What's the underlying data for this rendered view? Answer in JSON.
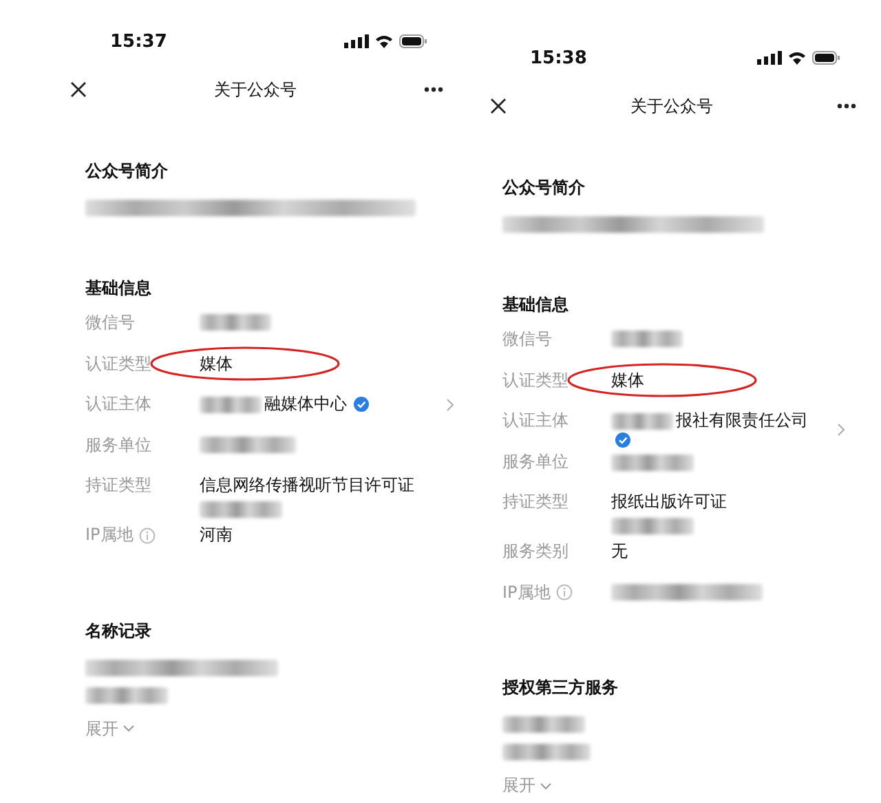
{
  "phones": [
    {
      "status_bar": {
        "time": "15:37"
      },
      "nav": {
        "title": "关于公众号"
      },
      "sections": [
        {
          "title": "公众号简介",
          "items": [
            {
              "kind": "blurline"
            }
          ]
        },
        {
          "title": "基础信息",
          "items": [
            {
              "kind": "field",
              "label": "微信号",
              "info": false,
              "verified": false,
              "chevron": false,
              "circled": false,
              "parts": [
                {
                  "kind": "blur"
                }
              ]
            },
            {
              "kind": "field",
              "label": "认证类型",
              "info": false,
              "verified": false,
              "chevron": false,
              "circled": true,
              "parts": [
                {
                  "kind": "text",
                  "text": "媒体"
                }
              ]
            },
            {
              "kind": "field",
              "label": "认证主体",
              "info": false,
              "verified": true,
              "chevron": true,
              "circled": false,
              "parts": [
                {
                  "kind": "blur"
                },
                {
                  "kind": "text",
                  "text": "融媒体中心"
                }
              ]
            },
            {
              "kind": "field",
              "label": "服务单位",
              "info": false,
              "verified": false,
              "chevron": false,
              "circled": false,
              "parts": [
                {
                  "kind": "blur"
                }
              ]
            },
            {
              "kind": "field",
              "label": "持证类型",
              "info": false,
              "verified": false,
              "chevron": false,
              "circled": false,
              "parts": [
                {
                  "kind": "text",
                  "text": "信息网络传播视听节目许可证"
                },
                {
                  "kind": "blurline"
                }
              ]
            },
            {
              "kind": "field",
              "label": "IP属地",
              "info": true,
              "verified": false,
              "chevron": false,
              "circled": false,
              "parts": [
                {
                  "kind": "text",
                  "text": "河南"
                }
              ]
            }
          ]
        },
        {
          "title": "名称记录",
          "items": [
            {
              "kind": "blurline"
            },
            {
              "kind": "blur"
            },
            {
              "kind": "expand",
              "text": "展开"
            }
          ]
        }
      ]
    },
    {
      "status_bar": {
        "time": "15:38"
      },
      "nav": {
        "title": "关于公众号"
      },
      "sections": [
        {
          "title": "公众号简介",
          "items": [
            {
              "kind": "blurline"
            }
          ]
        },
        {
          "title": "基础信息",
          "items": [
            {
              "kind": "field",
              "label": "微信号",
              "info": false,
              "verified": false,
              "chevron": false,
              "circled": false,
              "parts": [
                {
                  "kind": "blur"
                }
              ]
            },
            {
              "kind": "field",
              "label": "认证类型",
              "info": false,
              "verified": false,
              "chevron": false,
              "circled": true,
              "parts": [
                {
                  "kind": "text",
                  "text": "媒体"
                }
              ]
            },
            {
              "kind": "field",
              "label": "认证主体",
              "info": false,
              "verified": true,
              "chevron": true,
              "circled": false,
              "parts": [
                {
                  "kind": "blur"
                },
                {
                  "kind": "text",
                  "text": "报社有限责任公司"
                }
              ]
            },
            {
              "kind": "field",
              "label": "服务单位",
              "info": false,
              "verified": false,
              "chevron": false,
              "circled": false,
              "parts": [
                {
                  "kind": "blurline"
                }
              ]
            },
            {
              "kind": "field",
              "label": "持证类型",
              "info": false,
              "verified": false,
              "chevron": false,
              "circled": false,
              "parts": [
                {
                  "kind": "text",
                  "text": "报纸出版许可证"
                },
                {
                  "kind": "blurline"
                }
              ]
            },
            {
              "kind": "field",
              "label": "服务类别",
              "info": false,
              "verified": false,
              "chevron": false,
              "circled": false,
              "parts": [
                {
                  "kind": "text",
                  "text": "无"
                }
              ]
            },
            {
              "kind": "field",
              "label": "IP属地",
              "info": true,
              "verified": false,
              "chevron": false,
              "circled": false,
              "parts": [
                {
                  "kind": "blur"
                }
              ]
            }
          ]
        },
        {
          "title": "授权第三方服务",
          "items": [
            {
              "kind": "blur"
            },
            {
              "kind": "blur"
            },
            {
              "kind": "expand",
              "text": "展开"
            }
          ]
        }
      ]
    }
  ]
}
